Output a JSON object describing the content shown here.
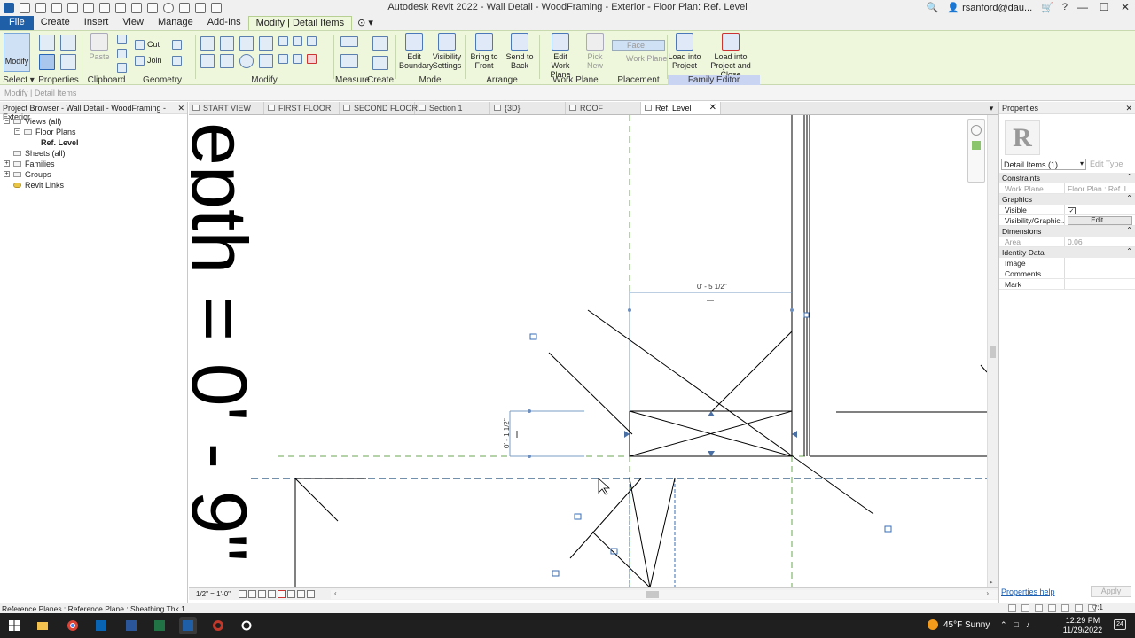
{
  "titlebar": {
    "title": "Autodesk Revit 2022 - Wall Detail - WoodFraming - Exterior - Floor Plan: Ref. Level",
    "user": "rsanford@dau...",
    "minimize": "—",
    "maximize": "☐",
    "close": "✕"
  },
  "ribbon_tabs": [
    "File",
    "Create",
    "Insert",
    "View",
    "Manage",
    "Add-Ins",
    "Modify | Detail Items"
  ],
  "ribbon": {
    "modify_label": "Modify",
    "select_label": "Select ▾",
    "properties_label": "Properties",
    "clipboard_label": "Clipboard",
    "paste_label": "Paste",
    "cut_label": "Cut",
    "join_label": "Join",
    "geometry_label": "Geometry",
    "modify_panel_label": "Modify",
    "measure_label": "Measure",
    "create_label": "Create",
    "mode_label": "Mode",
    "arrange_label": "Arrange",
    "work_plane_label": "Work Plane",
    "placement_label": "Placement",
    "family_editor_label": "Family Editor",
    "edit_boundary": [
      "Edit",
      "Boundary"
    ],
    "visibility_settings": [
      "Visibility",
      "Settings"
    ],
    "bring_to_front": [
      "Bring to",
      "Front"
    ],
    "send_to_back": [
      "Send to",
      "Back"
    ],
    "edit_work_plane": [
      "Edit",
      "Work Plane"
    ],
    "pick_new": [
      "Pick",
      "New"
    ],
    "face_label": "Face",
    "work_plane_btn": "Work Plane",
    "load_into_project": [
      "Load into",
      "Project"
    ],
    "load_into_project_close": [
      "Load into",
      "Project and Close"
    ]
  },
  "options_bar": "Modify | Detail Items",
  "project_browser": {
    "title": "Project Browser - Wall Detail - WoodFraming - Exterior",
    "close": "✕",
    "nodes": [
      {
        "label": "Views (all)",
        "toggle": "−",
        "level": 0,
        "bold": false
      },
      {
        "label": "Floor Plans",
        "toggle": "−",
        "level": 1,
        "bold": false
      },
      {
        "label": "Ref. Level",
        "toggle": "",
        "level": 2,
        "bold": true
      },
      {
        "label": "Sheets (all)",
        "toggle": "",
        "level": 0,
        "bold": false
      },
      {
        "label": "Families",
        "toggle": "+",
        "level": 0,
        "bold": false
      },
      {
        "label": "Groups",
        "toggle": "+",
        "level": 0,
        "bold": false
      },
      {
        "label": "Revit Links",
        "toggle": "",
        "level": 0,
        "bold": false
      }
    ]
  },
  "view_tabs": [
    {
      "label": "START VIEW",
      "active": false
    },
    {
      "label": "FIRST FLOOR",
      "active": false
    },
    {
      "label": "SECOND FLOOR",
      "active": false
    },
    {
      "label": "Section 1",
      "active": false
    },
    {
      "label": "{3D}",
      "active": false
    },
    {
      "label": "ROOF",
      "active": false
    },
    {
      "label": "Ref. Level",
      "active": true
    }
  ],
  "canvas": {
    "big_text": "epth = 0' - 9\"",
    "dim_horizontal": "0' - 5 1/2\"",
    "dim_vertical": "0' - 1 1/2\""
  },
  "view_control": {
    "scale": "1/2\" = 1'-0\""
  },
  "properties": {
    "title": "Properties",
    "close": "✕",
    "logo": "R",
    "type_selector": "Detail Items (1)",
    "edit_type": "Edit Type",
    "groups": [
      {
        "name": "Constraints",
        "rows": [
          {
            "k": "Work Plane",
            "v": "Floor Plan : Ref. L...",
            "dim": true
          }
        ]
      },
      {
        "name": "Graphics",
        "rows": [
          {
            "k": "Visible",
            "v": "✓",
            "type": "check"
          },
          {
            "k": "Visibility/Graphic...",
            "v": "Edit...",
            "type": "button"
          }
        ]
      },
      {
        "name": "Dimensions",
        "rows": [
          {
            "k": "Area",
            "v": "0.06",
            "dim": true
          }
        ]
      },
      {
        "name": "Identity Data",
        "rows": [
          {
            "k": "Image",
            "v": ""
          },
          {
            "k": "Comments",
            "v": ""
          },
          {
            "k": "Mark",
            "v": ""
          }
        ]
      }
    ],
    "collapse": "⌃",
    "help": "Properties help",
    "apply": "Apply"
  },
  "status_bar": {
    "text": "Reference Planes : Reference Plane : Sheathing Thk 1",
    "selection": "▽:1"
  },
  "taskbar": {
    "weather": "45°F  Sunny",
    "time": "12:29 PM",
    "date": "11/29/2022",
    "notifications": "24"
  },
  "colors": {
    "ribbon_bg": "#eef7dc",
    "file_tab": "#1f5fa8",
    "ref_plane_green": "#6aa84f",
    "ref_plane_blue": "#1f4e79",
    "selection_blue": "#3a6db5"
  }
}
